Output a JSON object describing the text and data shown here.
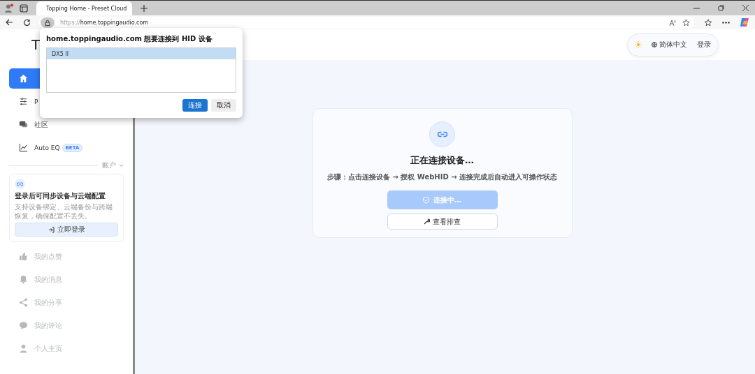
{
  "browser": {
    "tab_title": "Topping Home - Preset Cloud",
    "url_scheme": "https://",
    "url_host": "home.toppingaudio.com"
  },
  "dialog": {
    "title": "home.toppingaudio.com 想要连接到 HID 设备",
    "devices": [
      {
        "label": "DX5 II",
        "selected": true
      }
    ],
    "confirm": "连接",
    "cancel": "取消"
  },
  "sidebar": {
    "logo": "T",
    "nav": [
      {
        "selected": true
      },
      {
        "label": "P",
        "selected": false
      },
      {
        "label": "社区",
        "selected": false
      },
      {
        "label": "Auto EQ",
        "selected": false,
        "badge": "BETA"
      }
    ],
    "section_label": "账户",
    "login_card": {
      "title": "登录后可同步设备与云端配置",
      "description": "支持设备绑定、云端备份与跨端恢复，确保配置不丢失。",
      "button": "立即登录"
    },
    "account_items": [
      {
        "label": "我的点赞",
        "disabled": true
      },
      {
        "label": "我的消息",
        "disabled": true
      },
      {
        "label": "我的分享",
        "disabled": true
      },
      {
        "label": "我的评论",
        "disabled": true
      },
      {
        "label": "个人主页",
        "disabled": true
      }
    ]
  },
  "header": {
    "language": "简体中文",
    "login": "登录"
  },
  "connect_card": {
    "title": "正在连接设备…",
    "steps": "步骤：点击连接设备 → 授权 WebHID → 连接完成后自动进入可操作状态",
    "primary_button": {
      "label": "连接中…",
      "disabled": true
    },
    "secondary_button": "查看排查"
  }
}
